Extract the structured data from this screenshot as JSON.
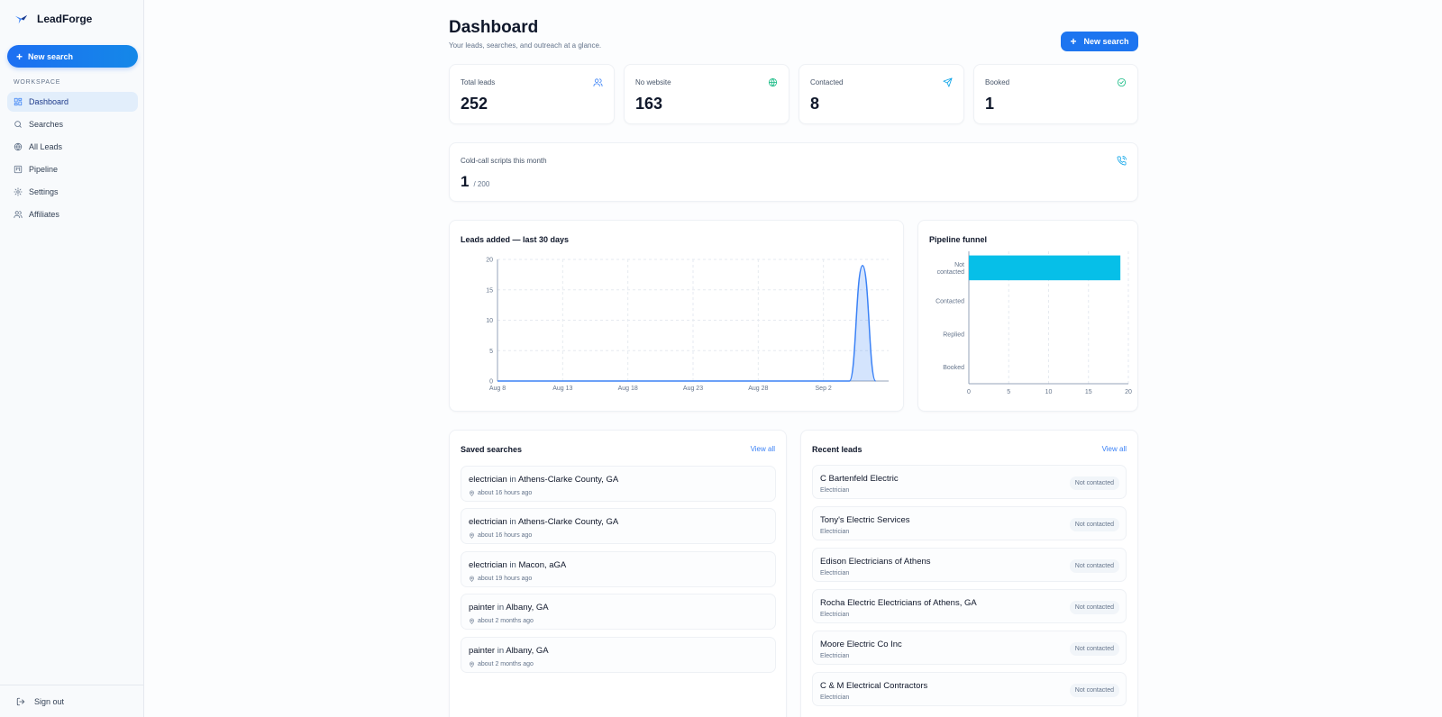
{
  "app": {
    "name": "LeadForge"
  },
  "sidebar": {
    "new_search": "New search",
    "section_label": "WORKSPACE",
    "items": [
      {
        "label": "Dashboard",
        "icon": "dashboard-icon",
        "active": true
      },
      {
        "label": "Searches",
        "icon": "search-icon"
      },
      {
        "label": "All Leads",
        "icon": "globe-icon"
      },
      {
        "label": "Pipeline",
        "icon": "kanban-icon"
      },
      {
        "label": "Settings",
        "icon": "gear-icon"
      },
      {
        "label": "Affiliates",
        "icon": "users-icon"
      }
    ],
    "sign_out": "Sign out"
  },
  "header": {
    "title": "Dashboard",
    "subtitle": "Your leads, searches, and outreach at a glance.",
    "new_search": "New search"
  },
  "stats": [
    {
      "label": "Total leads",
      "value": "252",
      "icon": "users-icon",
      "color": "#3b82f6"
    },
    {
      "label": "No website",
      "value": "163",
      "icon": "globe-icon",
      "color": "#10b981"
    },
    {
      "label": "Contacted",
      "value": "8",
      "icon": "send-icon",
      "color": "#0ea5e9"
    },
    {
      "label": "Booked",
      "value": "1",
      "icon": "check-circle-icon",
      "color": "#10b981"
    }
  ],
  "quota": {
    "label": "Cold-call scripts this month",
    "value": "1",
    "max": "/ 200",
    "icon": "phone-icon"
  },
  "leads_chart": {
    "title": "Leads added — last 30 days",
    "chart_data": {
      "type": "area",
      "x_ticks": [
        "Aug 8",
        "Aug 13",
        "Aug 18",
        "Aug 23",
        "Aug 28",
        "Sep 2"
      ],
      "y_ticks": [
        "0",
        "5",
        "10",
        "15",
        "20"
      ],
      "ylim": [
        0,
        20
      ],
      "grid": true,
      "series": [
        {
          "color": "#3b82f6",
          "x": [
            "Aug 8",
            "Aug 9",
            "Aug 10",
            "Aug 11",
            "Aug 12",
            "Aug 13",
            "Aug 14",
            "Aug 15",
            "Aug 16",
            "Aug 17",
            "Aug 18",
            "Aug 19",
            "Aug 20",
            "Aug 21",
            "Aug 22",
            "Aug 23",
            "Aug 24",
            "Aug 25",
            "Aug 26",
            "Aug 27",
            "Aug 28",
            "Aug 29",
            "Aug 30",
            "Aug 31",
            "Sep 1",
            "Sep 2",
            "Sep 3",
            "Sep 4",
            "Sep 5",
            "Sep 6"
          ],
          "values": [
            0,
            0,
            0,
            0,
            0,
            0,
            0,
            0,
            0,
            0,
            0,
            0,
            0,
            0,
            0,
            0,
            0,
            0,
            0,
            0,
            0,
            0,
            0,
            0,
            0,
            0,
            0,
            0,
            19,
            0
          ]
        }
      ]
    }
  },
  "funnel_chart": {
    "title": "Pipeline funnel",
    "chart_data": {
      "type": "bar",
      "orientation": "horizontal",
      "categories": [
        "Not contacted",
        "Contacted",
        "Replied",
        "Booked"
      ],
      "category_lines": [
        [
          "Not",
          "contacted"
        ],
        [
          "Contacted"
        ],
        [
          "Replied"
        ],
        [
          "Booked"
        ]
      ],
      "values": [
        19,
        0,
        0,
        0
      ],
      "x_ticks": [
        "0",
        "5",
        "10",
        "15",
        "20"
      ],
      "xlim": [
        0,
        20
      ],
      "color": "#06bfe8",
      "grid": true
    }
  },
  "saved_searches": {
    "title": "Saved searches",
    "view_all": "View all",
    "connector": "in",
    "items": [
      {
        "term": "electrician",
        "place": "Athens-Clarke County, GA",
        "time": "about 16 hours ago"
      },
      {
        "term": "electrician",
        "place": "Athens-Clarke County, GA",
        "time": "about 16 hours ago"
      },
      {
        "term": "electrician",
        "place": "Macon, aGA",
        "time": "about 19 hours ago"
      },
      {
        "term": "painter",
        "place": "Albany, GA",
        "time": "about 2 months ago"
      },
      {
        "term": "painter",
        "place": "Albany, GA",
        "time": "about 2 months ago"
      }
    ]
  },
  "recent_leads": {
    "title": "Recent leads",
    "view_all": "View all",
    "items": [
      {
        "name": "C Bartenfeld Electric",
        "type": "Electrician",
        "status": "Not contacted"
      },
      {
        "name": "Tony's Electric Services",
        "type": "Electrician",
        "status": "Not contacted"
      },
      {
        "name": "Edison Electricians of Athens",
        "type": "Electrician",
        "status": "Not contacted"
      },
      {
        "name": "Rocha Electric Electricians of Athens, GA",
        "type": "Electrician",
        "status": "Not contacted"
      },
      {
        "name": "Moore Electric Co Inc",
        "type": "Electrician",
        "status": "Not contacted"
      },
      {
        "name": "C & M Electrical Contractors",
        "type": "Electrician",
        "status": "Not contacted"
      }
    ]
  }
}
